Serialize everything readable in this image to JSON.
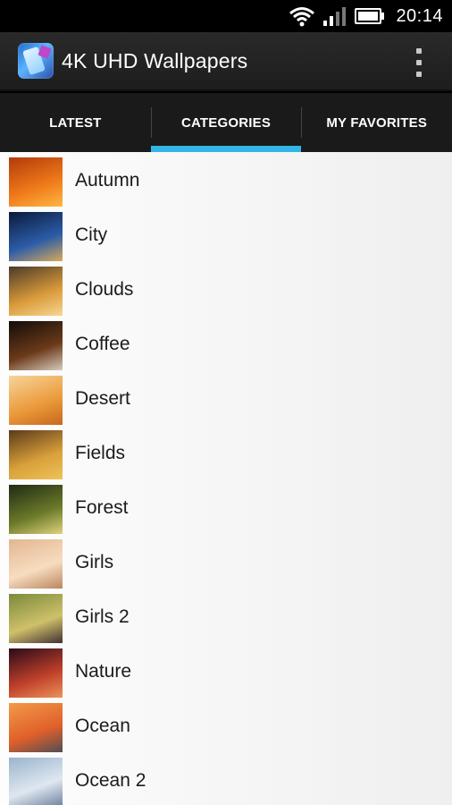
{
  "status_bar": {
    "time": "20:14",
    "icons": [
      "wifi-icon",
      "signal-icon",
      "battery-icon"
    ]
  },
  "action_bar": {
    "title": "4K UHD Wallpapers",
    "icon": "app-icon",
    "overflow_icon": "overflow-menu-icon"
  },
  "tabs": [
    {
      "label": "LATEST",
      "active": false
    },
    {
      "label": "CATEGORIES",
      "active": true
    },
    {
      "label": "MY FAVORITES",
      "active": false
    }
  ],
  "categories": [
    {
      "label": "Autumn",
      "thumb": [
        "#b23a0a",
        "#f07a1a",
        "#ffc14a"
      ]
    },
    {
      "label": "City",
      "thumb": [
        "#0b1a3a",
        "#2b5ca8",
        "#f2b64a"
      ]
    },
    {
      "label": "Clouds",
      "thumb": [
        "#4a3b2a",
        "#d99a3a",
        "#fbe0a0"
      ]
    },
    {
      "label": "Coffee",
      "thumb": [
        "#120c08",
        "#6b3a1a",
        "#e8e2d8"
      ]
    },
    {
      "label": "Desert",
      "thumb": [
        "#f7d49a",
        "#eb9a3a",
        "#c0601a"
      ]
    },
    {
      "label": "Fields",
      "thumb": [
        "#5a3a1a",
        "#d9a03a",
        "#f0c860"
      ]
    },
    {
      "label": "Forest",
      "thumb": [
        "#1f2a12",
        "#6b7a2a",
        "#f3e08a"
      ]
    },
    {
      "label": "Girls",
      "thumb": [
        "#e2b690",
        "#f7dcc0",
        "#b07a50"
      ]
    },
    {
      "label": "Girls 2",
      "thumb": [
        "#7a8a3a",
        "#cfc06a",
        "#2a1a2a"
      ]
    },
    {
      "label": "Nature",
      "thumb": [
        "#2a0a1a",
        "#c0402a",
        "#f2a060"
      ]
    },
    {
      "label": "Ocean",
      "thumb": [
        "#f29a4a",
        "#e0602a",
        "#3a4a5a"
      ]
    },
    {
      "label": "Ocean 2",
      "thumb": [
        "#9ab4cc",
        "#dfe7f0",
        "#5a7090"
      ]
    }
  ],
  "colors": {
    "accent": "#33b5e5",
    "action_bar": "#222222",
    "list_bg": "#f3f3f3"
  }
}
